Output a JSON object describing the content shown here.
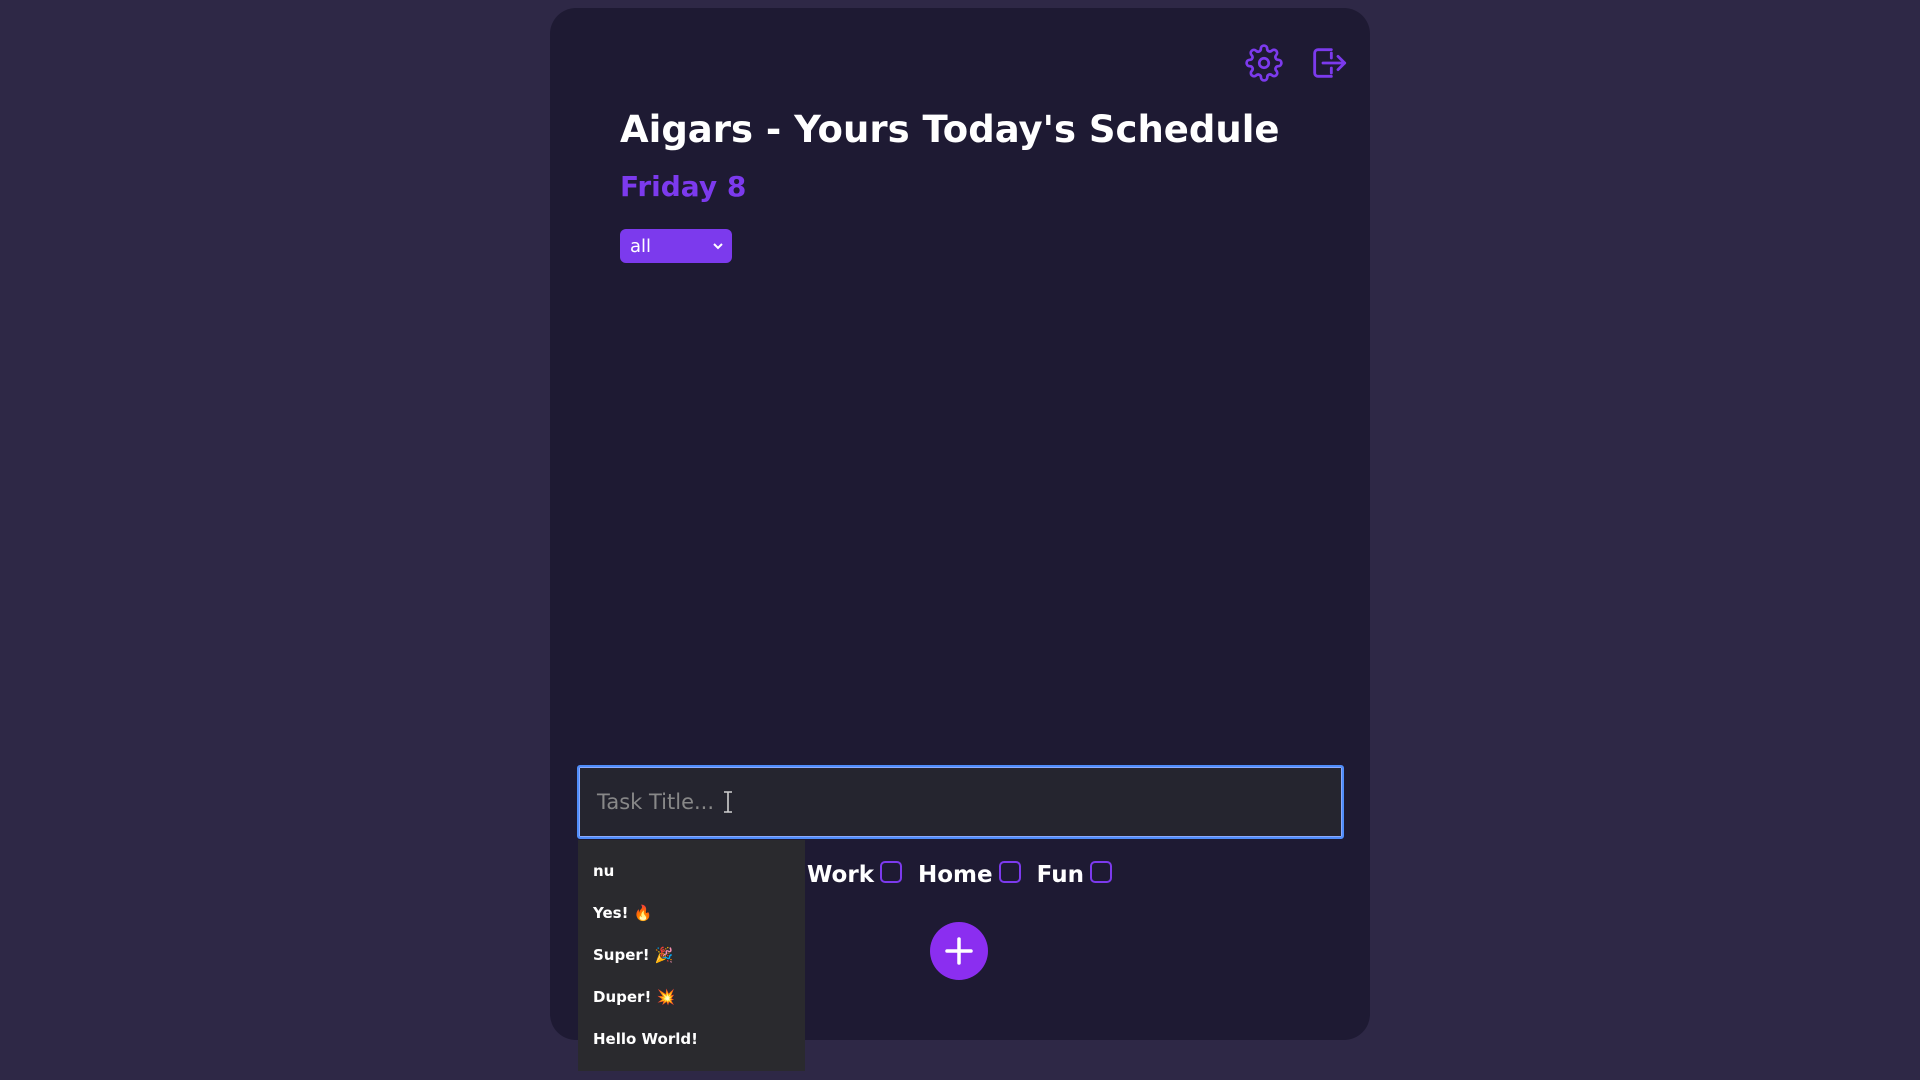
{
  "header": {
    "title": "Aigars - Yours Today's Schedule",
    "date": "Friday 8",
    "settings_icon": "gear-icon",
    "logout_icon": "logout-icon"
  },
  "filter": {
    "selected": "all"
  },
  "task_input": {
    "placeholder": "Task Title..."
  },
  "categories": [
    {
      "label": "Work"
    },
    {
      "label": "Home"
    },
    {
      "label": "Fun"
    }
  ],
  "add_button": {
    "icon": "plus-icon"
  },
  "suggestions": [
    {
      "label": "nu"
    },
    {
      "label": "Yes! 🔥"
    },
    {
      "label": "Super! 🎉"
    },
    {
      "label": "Duper! 💥"
    },
    {
      "label": "Hello World!"
    }
  ],
  "colors": {
    "background": "#2e2846",
    "card": "#1e1a33",
    "accent": "#7c3aed",
    "add_button": "#8b2ef0",
    "input_border": "#4f8dfb"
  }
}
